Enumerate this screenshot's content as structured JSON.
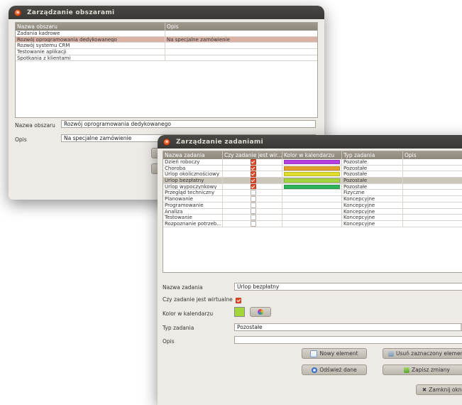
{
  "win1": {
    "title": "Zarządzanie obszarami",
    "table": {
      "headers": [
        "Nazwa obszaru",
        "Opis"
      ],
      "rows": [
        [
          "Zadania kadrowe",
          ""
        ],
        [
          "Rozwój oprogramowania dedykowanego",
          "Na specjalne zamówienie"
        ],
        [
          "Rozwój systemu CRM",
          ""
        ],
        [
          "Testowanie aplikacji",
          ""
        ],
        [
          "Spotkania z klientami",
          ""
        ]
      ],
      "selected_index": 1
    },
    "name_label": "Nazwa obszaru",
    "name_value": "Rozwój oprogramowania dedykowanego",
    "desc_label": "Opis",
    "desc_value": "Na specjalne zamówienie"
  },
  "win2": {
    "title": "Zarządzanie zadaniami",
    "table": {
      "headers": [
        "Nazwa zadania",
        "Czy zadanie jest wir...",
        "Kolor w kalendarzu",
        "Typ zadania",
        "Opis"
      ],
      "rows": [
        {
          "name": "Dzień roboczy",
          "virtual": true,
          "color": "#b43ee0",
          "type": "Pozostałe"
        },
        {
          "name": "Choroba",
          "virtual": true,
          "color": "#e3a12a",
          "type": "Pozostałe"
        },
        {
          "name": "Urlop okolicznościowy",
          "virtual": true,
          "color": "#dfdc2c",
          "type": "Pozostałe"
        },
        {
          "name": "Urlop bezpłatny",
          "virtual": true,
          "color": "#a4d63c",
          "type": "Pozostałe"
        },
        {
          "name": "Urlop wypoczynkowy",
          "virtual": true,
          "color": "#2fb35a",
          "type": "Pozostałe"
        },
        {
          "name": "Przegląd techniczny",
          "virtual": false,
          "color": "",
          "type": "Fizyczne"
        },
        {
          "name": "Planowanie",
          "virtual": false,
          "color": "",
          "type": "Koncepcyjne"
        },
        {
          "name": "Programowanie",
          "virtual": false,
          "color": "",
          "type": "Koncepcyjne"
        },
        {
          "name": "Analiza",
          "virtual": false,
          "color": "",
          "type": "Koncepcyjne"
        },
        {
          "name": "Testowanie",
          "virtual": false,
          "color": "",
          "type": "Koncepcyjne"
        },
        {
          "name": "Rozpoznanie potrzeb...",
          "virtual": false,
          "color": "",
          "type": "Koncepcyjne"
        }
      ],
      "selected_index": 3
    },
    "form": {
      "name_label": "Nazwa zadania",
      "name_value": "Urlop bezpłatny",
      "virtual_label": "Czy zadanie jest wirtualne",
      "virtual_checked": true,
      "color_label": "Kolor w kalendarzu",
      "color_value": "#a4d63c",
      "type_label": "Typ zadania",
      "type_value": "Pozostałe",
      "desc_label": "Opis",
      "desc_value": ""
    },
    "buttons": {
      "new": "Nowy element",
      "delete": "Usuń zaznaczony element",
      "refresh": "Odśwież dane",
      "save": "Zapisz zmiany",
      "close": "Zamknij okno"
    }
  }
}
